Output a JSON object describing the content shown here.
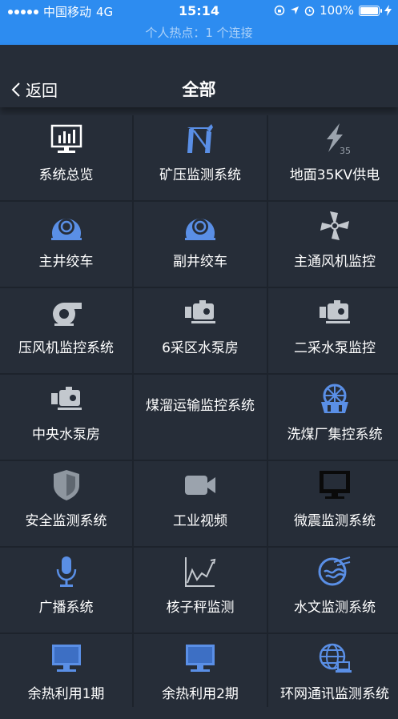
{
  "status_bar": {
    "carrier": "中国移动",
    "network": "4G",
    "time": "15:14",
    "battery": "100%"
  },
  "hotspot_text": "个人热点：1 个连接",
  "nav": {
    "back_label": "返回",
    "title": "全部"
  },
  "colors": {
    "status_bar_bg": "#2d8cf0",
    "page_bg": "#262d38",
    "icon_blue": "#5a8fe6",
    "icon_gray": "#9ba3ad"
  },
  "grid_items": [
    {
      "label": "系统总览",
      "icon": "monitor-chart-icon"
    },
    {
      "label": "矿压监测系统",
      "icon": "crane-icon"
    },
    {
      "label": "地面35KV供电",
      "icon": "lightning-35-icon"
    },
    {
      "label": "主井绞车",
      "icon": "winch-icon"
    },
    {
      "label": "副井绞车",
      "icon": "winch-icon"
    },
    {
      "label": "主通风机监控",
      "icon": "fan-icon"
    },
    {
      "label": "压风机监控系统",
      "icon": "blower-icon"
    },
    {
      "label": "6采区水泵房",
      "icon": "pump-icon"
    },
    {
      "label": "二采水泵监控",
      "icon": "pump-icon"
    },
    {
      "label": "中央水泵房",
      "icon": "pump-icon"
    },
    {
      "label": "煤溜运输监控系统",
      "icon": ""
    },
    {
      "label": "洗煤厂集控系统",
      "icon": "wash-plant-icon"
    },
    {
      "label": "安全监测系统",
      "icon": "shield-icon"
    },
    {
      "label": "工业视频",
      "icon": "video-camera-icon"
    },
    {
      "label": "微震监测系统",
      "icon": "computer-monitor-icon"
    },
    {
      "label": "广播系统",
      "icon": "microphone-icon"
    },
    {
      "label": "核子秤监测",
      "icon": "line-chart-icon"
    },
    {
      "label": "水文监测系统",
      "icon": "hydrology-icon"
    },
    {
      "label": "余热利用1期",
      "icon": "desktop-icon"
    },
    {
      "label": "余热利用2期",
      "icon": "desktop-icon"
    },
    {
      "label": "环网通讯监测系统",
      "icon": "network-globe-icon"
    }
  ]
}
